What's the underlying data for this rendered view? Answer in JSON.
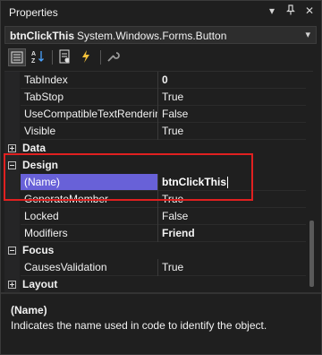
{
  "window": {
    "title": "Properties",
    "controls": {
      "dropdown": "▾",
      "pin": "📌",
      "close": "✕"
    }
  },
  "object_selector": {
    "name": "btnClickThis",
    "type": "System.Windows.Forms.Button",
    "dropdown_icon": "chevron-down-icon"
  },
  "toolbar": {
    "buttons": [
      {
        "name": "categorized-view",
        "active": true
      },
      {
        "name": "alphabetical-view",
        "active": false
      },
      {
        "name": "properties-view",
        "active": false
      },
      {
        "name": "events-view",
        "active": false
      },
      {
        "name": "property-pages",
        "active": false
      }
    ]
  },
  "grid": {
    "rows": [
      {
        "kind": "prop",
        "name": "TabIndex",
        "value": "0",
        "bold_value": true
      },
      {
        "kind": "prop",
        "name": "TabStop",
        "value": "True"
      },
      {
        "kind": "prop",
        "name": "UseCompatibleTextRendering",
        "value": "False"
      },
      {
        "kind": "prop",
        "name": "Visible",
        "value": "True"
      },
      {
        "kind": "category",
        "name": "Data",
        "expanded": false
      },
      {
        "kind": "category",
        "name": "Design",
        "expanded": true
      },
      {
        "kind": "prop",
        "name": "(Name)",
        "value": "btnClickThis",
        "selected": true,
        "editing": true
      },
      {
        "kind": "prop",
        "name": "GenerateMember",
        "value": "True"
      },
      {
        "kind": "prop",
        "name": "Locked",
        "value": "False"
      },
      {
        "kind": "prop",
        "name": "Modifiers",
        "value": "Friend",
        "bold_value": true
      },
      {
        "kind": "category",
        "name": "Focus",
        "expanded": true
      },
      {
        "kind": "prop",
        "name": "CausesValidation",
        "value": "True"
      },
      {
        "kind": "category",
        "name": "Layout",
        "expanded": false
      }
    ]
  },
  "description": {
    "title": "(Name)",
    "text": "Indicates the name used in code to identify the object."
  },
  "colors": {
    "background": "#1f1f1f",
    "selection": "#6861d8",
    "highlight_box": "#e02020",
    "text": "#f1f1f1"
  }
}
